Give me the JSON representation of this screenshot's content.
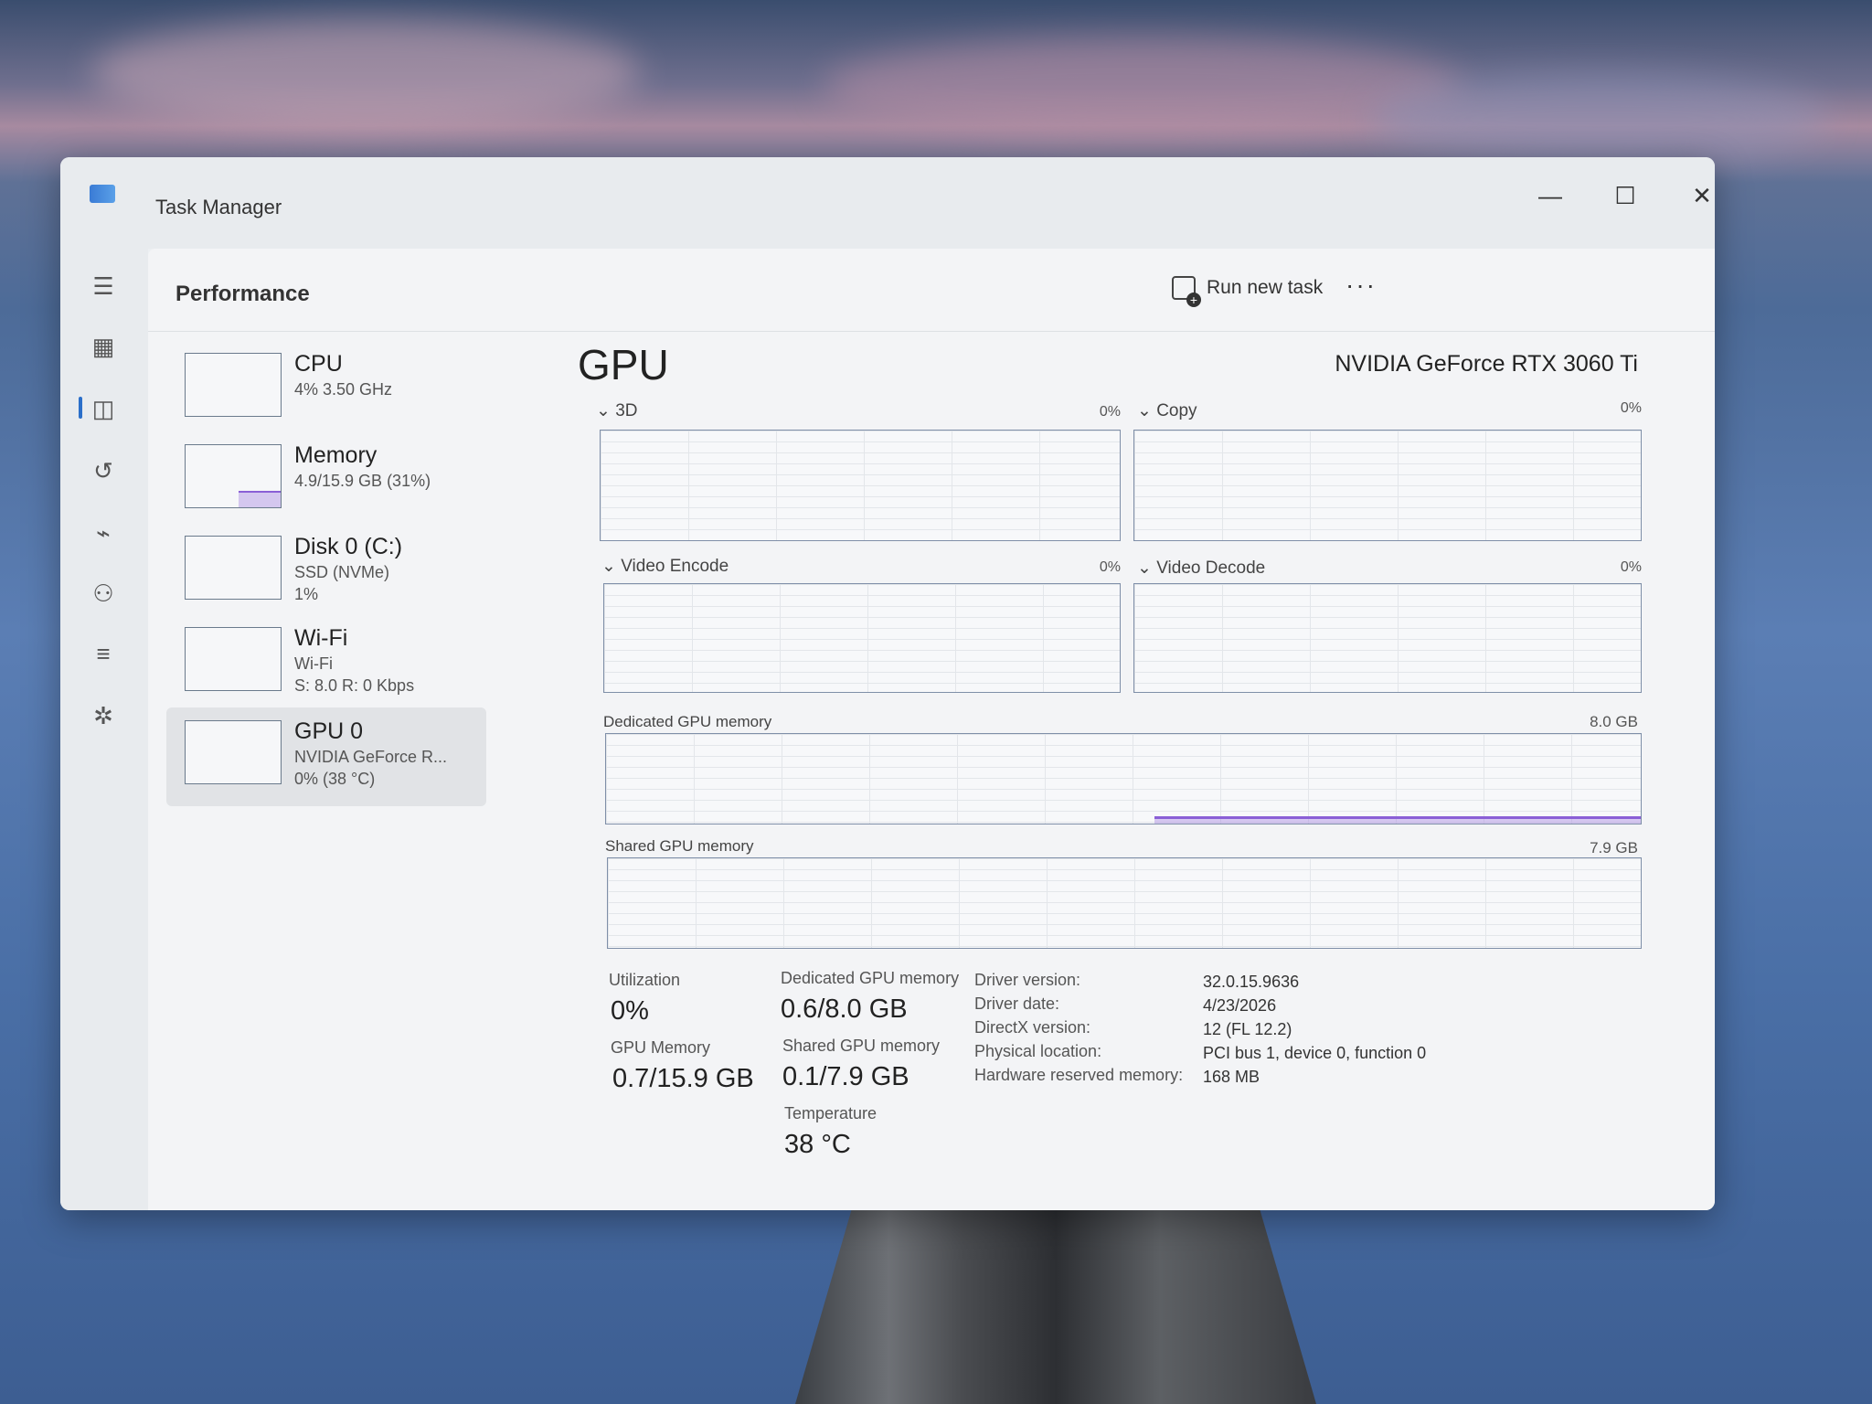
{
  "window": {
    "title": "Task Manager"
  },
  "title_buttons": {
    "minimize": "—",
    "maximize": "☐",
    "close": "✕"
  },
  "header": {
    "section": "Performance",
    "run_new_task": "Run new task",
    "more": "···"
  },
  "devices": [
    {
      "name": "CPU",
      "sub1": "4% 3.50 GHz",
      "sub2": "",
      "sub3": ""
    },
    {
      "name": "Memory",
      "sub1": "4.9/15.9 GB (31%)",
      "sub2": "",
      "sub3": ""
    },
    {
      "name": "Disk 0 (C:)",
      "sub1": "SSD (NVMe)",
      "sub2": "1%",
      "sub3": ""
    },
    {
      "name": "Wi-Fi",
      "sub1": "Wi-Fi",
      "sub2": "S: 8.0 R: 0 Kbps",
      "sub3": ""
    },
    {
      "name": "GPU 0",
      "sub1": "NVIDIA GeForce R...",
      "sub2": "0% (38 °C)",
      "sub3": ""
    }
  ],
  "gpu": {
    "title": "GPU",
    "model": "NVIDIA GeForce RTX 3060 Ti",
    "engines": [
      {
        "label": "3D",
        "pct": "0%"
      },
      {
        "label": "Copy",
        "pct": "0%"
      },
      {
        "label": "Video Encode",
        "pct": "0%"
      },
      {
        "label": "Video Decode",
        "pct": "0%"
      }
    ],
    "dedicated_label": "Dedicated GPU memory",
    "dedicated_max": "8.0 GB",
    "dedicated_usage_fraction": 0.075,
    "shared_label": "Shared GPU memory",
    "shared_max": "7.9 GB",
    "stats": {
      "utilization_label": "Utilization",
      "utilization_value": "0%",
      "dedicated_label": "Dedicated GPU memory",
      "dedicated_value": "0.6/8.0 GB",
      "gpu_memory_label": "GPU Memory",
      "gpu_memory_value": "0.7/15.9 GB",
      "shared_label": "Shared GPU memory",
      "shared_value": "0.1/7.9 GB",
      "temperature_label": "Temperature",
      "temperature_value": "38 °C"
    },
    "info": [
      {
        "label": "Driver version:",
        "value": "32.0.15.9636"
      },
      {
        "label": "Driver date:",
        "value": "4/23/2026"
      },
      {
        "label": "DirectX version:",
        "value": "12 (FL 12.2)"
      },
      {
        "label": "Physical location:",
        "value": "PCI bus 1, device 0, function 0"
      },
      {
        "label": "Hardware reserved memory:",
        "value": "168 MB"
      }
    ]
  },
  "colors": {
    "accent": "#2b6fc9",
    "graph_border": "#7f8fa8",
    "memory_line": "#8a5fd6"
  },
  "nav_icons": [
    "hamburger-icon",
    "processes-icon",
    "performance-icon",
    "app-history-icon",
    "startup-apps-icon",
    "users-icon",
    "details-icon",
    "services-icon",
    "settings-icon"
  ]
}
